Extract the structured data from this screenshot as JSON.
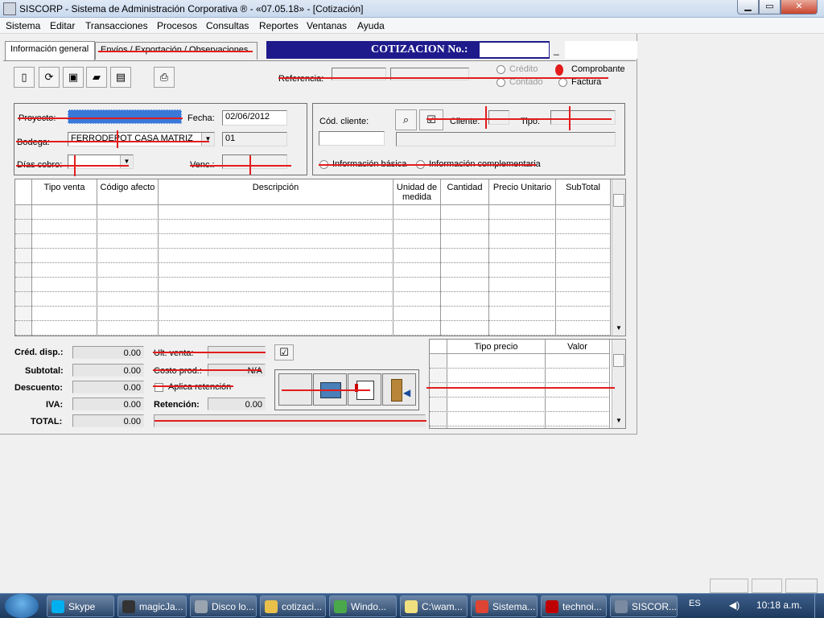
{
  "window": {
    "title": "SISCORP  - Sistema de Administración Corporativa ® - «07.05.18» - [Cotización]",
    "min_glyph": "▁",
    "max_glyph": "▭",
    "close_glyph": "✕"
  },
  "menu": [
    "Sistema",
    "Editar",
    "Transacciones",
    "Procesos",
    "Consultas",
    "Reportes",
    "Ventanas",
    "Ayuda"
  ],
  "tabs": {
    "general": "Información general",
    "envios": "Envíos / Exportación / Observaciones"
  },
  "header": {
    "cotizacion_label": "COTIZACION No.:",
    "dash": "_",
    "referencia_label": "Referencia:",
    "radio_credito": "Crédito",
    "radio_contado": "Contado",
    "comprobante_label": "Comprobante",
    "factura_label": "Factura"
  },
  "toolbar_icons": [
    "new-doc-icon",
    "refresh-icon",
    "preview-icon",
    "open-folder-icon",
    "save-icon",
    "print-icon"
  ],
  "left_panel": {
    "proyecto_label": "Proyecto:",
    "fecha_label": "Fecha:",
    "fecha_value": "02/06/2012",
    "bodega_label": "Bodega:",
    "bodega_value": "FERRODEPOT CASA MATRIZ",
    "bodega_code": "01",
    "dias_cobro_label": "Días cobro:",
    "venc_label": "Venc.:"
  },
  "right_panel": {
    "cod_cliente_label": "Cód. cliente:",
    "cliente_label": "Cliente:",
    "tipo_label": "Tipo:",
    "radio_basica": "Información básica",
    "radio_complementaria": "Información complementaria"
  },
  "grid": {
    "headers": [
      "Tipo venta",
      "Código afecto",
      "Descripción",
      "Unidad de medida",
      "Cantidad",
      "Precio Unitario",
      "SubTotal"
    ],
    "rows": 9
  },
  "totals": {
    "cred_disp_label": "Créd. disp.:",
    "cred_disp_value": "0.00",
    "subtotal_label": "Subtotal:",
    "subtotal_value": "0.00",
    "descuento_label": "Descuento:",
    "descuento_value": "0.00",
    "iva_label": "IVA:",
    "iva_value": "0.00",
    "total_label": "TOTAL:",
    "total_value": "0.00",
    "ult_venta_label": "Ult. venta:",
    "costo_prod_label": "Costo prod.:",
    "costo_prod_value": "N/A",
    "aplica_retencion_label": "Aplica retención",
    "retencion_label": "Retención:",
    "retencion_value": "0.00"
  },
  "price_grid": {
    "headers": [
      "Tipo precio",
      "Valor"
    ]
  },
  "taskbar": {
    "items": [
      {
        "label": "Skype",
        "icon": "skype-icon",
        "color": "#00aff0"
      },
      {
        "label": "magicJa...",
        "icon": "calculator-icon",
        "color": "#333333"
      },
      {
        "label": "Disco lo...",
        "icon": "drive-icon",
        "color": "#9aa4b0"
      },
      {
        "label": "cotizaci...",
        "icon": "folder-icon",
        "color": "#e8c04a"
      },
      {
        "label": "Windo...",
        "icon": "messenger-icon",
        "color": "#4aa84a"
      },
      {
        "label": "C:\\wam...",
        "icon": "editor-icon",
        "color": "#f0e080"
      },
      {
        "label": "Sistema...",
        "icon": "chrome-icon",
        "color": "#dd4433"
      },
      {
        "label": "technoi...",
        "icon": "filezilla-icon",
        "color": "#bf0000"
      },
      {
        "label": "SISCOR...",
        "icon": "app-window-icon",
        "color": "#7a8aa0"
      }
    ],
    "lang": "ES",
    "time": "10:18 a.m."
  }
}
